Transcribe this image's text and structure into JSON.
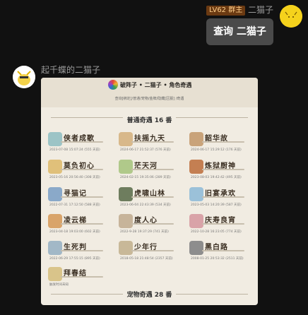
{
  "sender_right": {
    "badge": "LV62 群主",
    "name": "二猫子",
    "message": "查询 二猫子"
  },
  "sender_left": {
    "name": "起千蝶的二猫子"
  },
  "card": {
    "title": "破阵子 • 二猫子 • 角色奇遇",
    "subtitle": "查询[绑定]/普通/宠物/金牌/隐藏[区服] /奇遇",
    "section_normal": "普通奇遇 16 番",
    "section_pet": "宠物奇遇 28 番",
    "colors": {
      "card_bg": "#f1ece2",
      "header_bg": "#e7e0d2"
    },
    "items": [
      {
        "name": "侠者成歌",
        "date": "2023-07-08 15:07:24 (555 天前)",
        "icon": "horse-icon",
        "color": "#9cc4c6"
      },
      {
        "name": "扶摇九天",
        "date": "2024-06-17 21:52:37 (576 天前)",
        "icon": "crane-icon",
        "color": "#d8b88a"
      },
      {
        "name": "韶华故",
        "date": "2024-06-17 15:29:12 (176 天前)",
        "icon": "scroll-icon",
        "color": "#c9a37a"
      },
      {
        "name": "莫负初心",
        "date": "2023-05-16 20:56:40 (308 天前)",
        "icon": "blossom-icon",
        "color": "#e0c07a"
      },
      {
        "name": "茫天河",
        "date": "2024-02-15 19:35:06 (289 天前)",
        "icon": "river-icon",
        "color": "#b0c98a"
      },
      {
        "name": "炼狱厨神",
        "date": "2023-08-03 19:42:42 (495 天前)",
        "icon": "pot-icon",
        "color": "#c47f52"
      },
      {
        "name": "寻猫记",
        "date": "2022-07-31 17:12:50 (588 天前)",
        "icon": "cat-icon",
        "color": "#8aa9c9"
      },
      {
        "name": "虎啸山林",
        "date": "2023-06-04 22:43:39 (534 天前)",
        "icon": "tiger-icon",
        "color": "#6e7d5e"
      },
      {
        "name": "旧宴承欢",
        "date": "2023-05-03 14:20:39 (587 天前)",
        "icon": "banquet-icon",
        "color": "#9bc1d9"
      },
      {
        "name": "凌云梯",
        "date": "2023-04-18 19:03:00 (602 天前)",
        "icon": "ladder-icon",
        "color": "#d9a46a"
      },
      {
        "name": "度人心",
        "date": "2022-9-28 19:37:29 (741 天前)",
        "icon": "monk-icon",
        "color": "#c7b49a"
      },
      {
        "name": "庆寿良宵",
        "date": "2022-10-28 16:23:05 (774 天前)",
        "icon": "lantern-icon",
        "color": "#d9a3a8"
      },
      {
        "name": "生死判",
        "date": "2022-06-29 17:55:15 (895 天前)",
        "icon": "judge-icon",
        "color": "#a2b8c7"
      },
      {
        "name": "少年行",
        "date": "2018-05-18 21:48:54 (2357 天前)",
        "icon": "youth-icon",
        "color": "#c8b898"
      },
      {
        "name": "黑白路",
        "date": "2008-01-25 20:53:32 (2511 天前)",
        "icon": "chess-icon",
        "color": "#8d8d8d"
      },
      {
        "name": "拜春结",
        "date": "触发时间未知",
        "icon": "spring-icon",
        "color": "#d9c48a"
      }
    ]
  }
}
